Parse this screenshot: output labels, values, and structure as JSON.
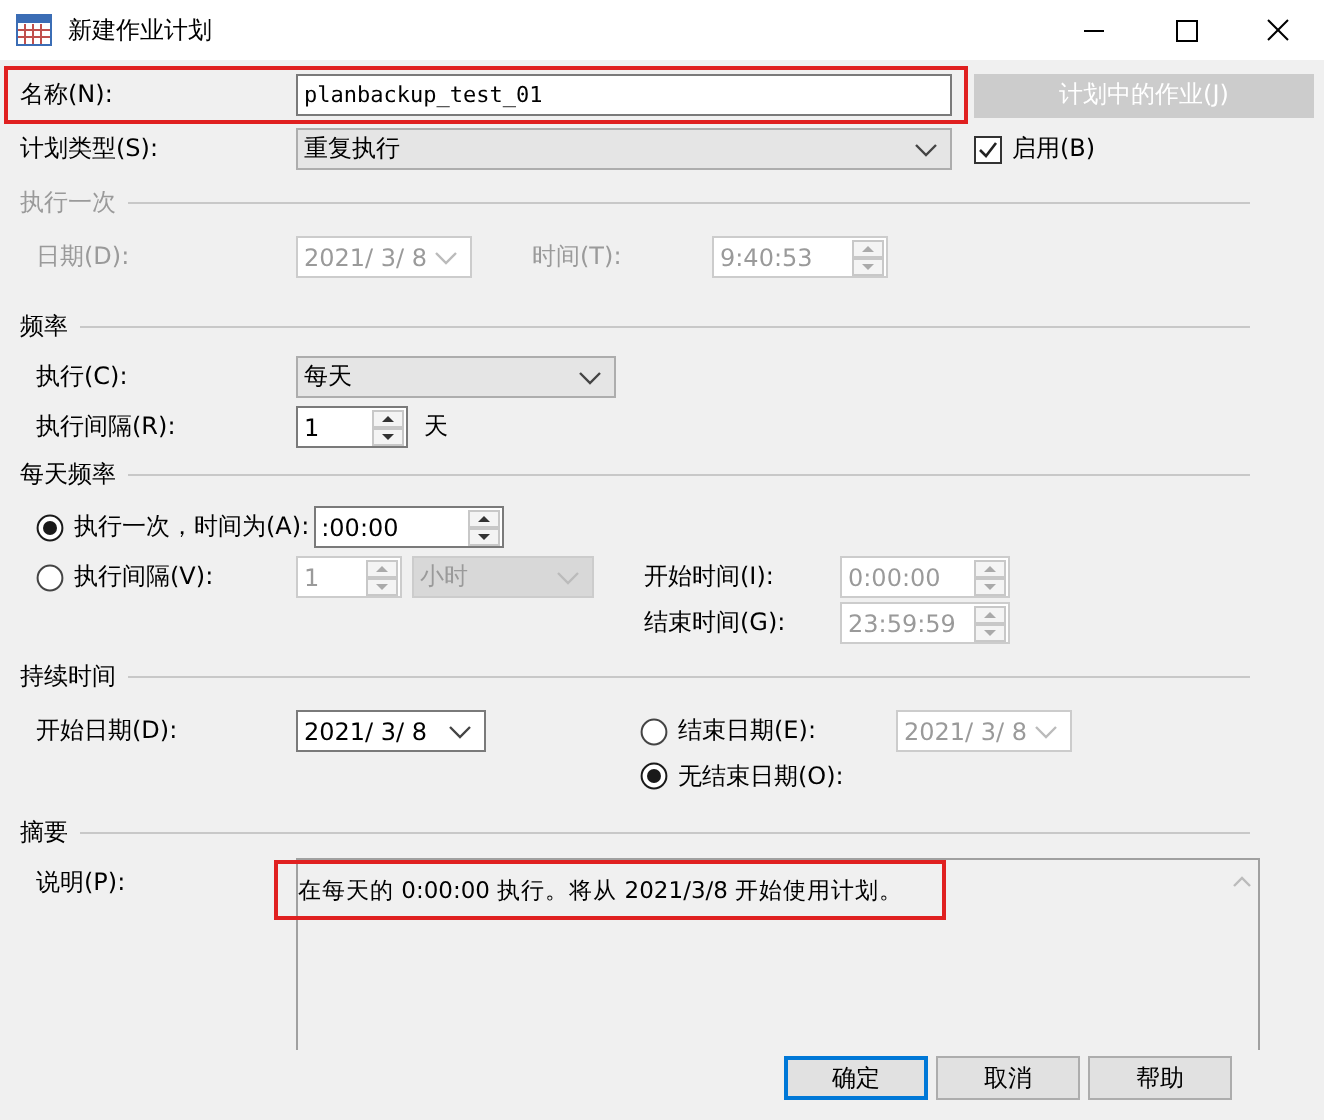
{
  "window": {
    "title": "新建作业计划"
  },
  "name": {
    "label": "名称(N):",
    "value": "planbackup_test_01",
    "highlighted": true
  },
  "jobs_button": {
    "label": "计划中的作业(J)",
    "disabled": true
  },
  "schedule_type": {
    "label": "计划类型(S):",
    "value": "重复执行"
  },
  "enabled": {
    "label": "启用(B)",
    "checked": true
  },
  "one_time": {
    "title": "执行一次",
    "disabled": true,
    "date_label": "日期(D):",
    "date": "2021/ 3/ 8",
    "time_label": "时间(T):",
    "time": "9:40:53"
  },
  "frequency": {
    "title": "频率",
    "occurs_label": "执行(C):",
    "occurs": "每天",
    "recurs_label": "执行间隔(R):",
    "recurs": "1",
    "recurs_unit": "天"
  },
  "daily_frequency": {
    "title": "每天频率",
    "options": [
      {
        "label": "执行一次，时间为(A):",
        "selected": true,
        "time": ":00:00"
      },
      {
        "label": "执行间隔(V):",
        "selected": false,
        "interval": "1",
        "unit": "小时",
        "start_label": "开始时间(I):",
        "start": "0:00:00",
        "end_label": "结束时间(G):",
        "end": "23:59:59"
      }
    ]
  },
  "duration": {
    "title": "持续时间",
    "start_label": "开始日期(D):",
    "start": "2021/ 3/ 8",
    "end_options": [
      {
        "label": "结束日期(E):",
        "selected": false,
        "date": "2021/ 3/ 8"
      },
      {
        "label": "无结束日期(O):",
        "selected": true
      }
    ]
  },
  "summary": {
    "title": "摘要",
    "label": "说明(P):",
    "text": "在每天的 0:00:00 执行。将从 2021/3/8 开始使用计划。",
    "highlighted": true
  },
  "buttons": [
    {
      "label": "确定",
      "default": true
    },
    {
      "label": "取消",
      "default": false
    },
    {
      "label": "帮助",
      "default": false
    }
  ]
}
